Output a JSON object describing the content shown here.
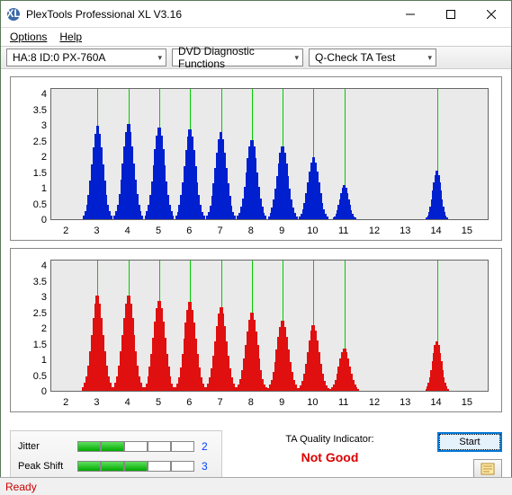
{
  "window": {
    "title": "PlexTools Professional XL V3.16"
  },
  "menu": {
    "options": "Options",
    "help": "Help"
  },
  "toolbar": {
    "drive": "HA:8 ID:0  PX-760A",
    "category": "DVD Diagnostic Functions",
    "test": "Q-Check TA Test"
  },
  "yticks": [
    "4",
    "3.5",
    "3",
    "2.5",
    "2",
    "1.5",
    "1",
    "0.5",
    "0"
  ],
  "xticks": [
    "2",
    "3",
    "4",
    "5",
    "6",
    "7",
    "8",
    "9",
    "10",
    "11",
    "12",
    "13",
    "14",
    "15"
  ],
  "chart_data": [
    {
      "type": "bar",
      "title": "",
      "xlabel": "",
      "ylabel": "",
      "ylim": [
        0,
        4.2
      ],
      "xlim": [
        1.5,
        15.5
      ],
      "color": "#0020d0",
      "gridlines_x": [
        3,
        4,
        5,
        6,
        7,
        8,
        9,
        10,
        11,
        14
      ],
      "series": [
        {
          "name": "peaks",
          "data": [
            {
              "center": 3,
              "width": 0.9,
              "height": 3.0
            },
            {
              "center": 4,
              "width": 0.9,
              "height": 3.05
            },
            {
              "center": 5,
              "width": 0.9,
              "height": 2.95
            },
            {
              "center": 6,
              "width": 0.9,
              "height": 2.9
            },
            {
              "center": 7,
              "width": 0.9,
              "height": 2.8
            },
            {
              "center": 8,
              "width": 0.9,
              "height": 2.55
            },
            {
              "center": 9,
              "width": 0.9,
              "height": 2.35
            },
            {
              "center": 10,
              "width": 0.9,
              "height": 2.0
            },
            {
              "center": 11,
              "width": 0.7,
              "height": 1.1
            },
            {
              "center": 14,
              "width": 0.65,
              "height": 1.55
            }
          ]
        }
      ]
    },
    {
      "type": "bar",
      "title": "",
      "xlabel": "",
      "ylabel": "",
      "ylim": [
        0,
        4.2
      ],
      "xlim": [
        1.5,
        15.5
      ],
      "color": "#e01010",
      "gridlines_x": [
        3,
        4,
        5,
        6,
        7,
        8,
        9,
        10,
        11,
        14
      ],
      "series": [
        {
          "name": "peaks",
          "data": [
            {
              "center": 3,
              "width": 0.95,
              "height": 3.05
            },
            {
              "center": 4,
              "width": 0.95,
              "height": 3.05
            },
            {
              "center": 5,
              "width": 0.95,
              "height": 2.9
            },
            {
              "center": 6,
              "width": 0.95,
              "height": 2.85
            },
            {
              "center": 7,
              "width": 0.95,
              "height": 2.7
            },
            {
              "center": 8,
              "width": 0.95,
              "height": 2.5
            },
            {
              "center": 9,
              "width": 0.95,
              "height": 2.25
            },
            {
              "center": 10,
              "width": 0.95,
              "height": 2.1
            },
            {
              "center": 11,
              "width": 0.9,
              "height": 1.35
            },
            {
              "center": 14,
              "width": 0.7,
              "height": 1.6
            }
          ]
        }
      ]
    }
  ],
  "metrics": {
    "jitter_label": "Jitter",
    "jitter_blocks": 2,
    "jitter_total": 5,
    "jitter_value": "2",
    "peak_label": "Peak Shift",
    "peak_blocks": 3,
    "peak_total": 5,
    "peak_value": "3"
  },
  "quality": {
    "label": "TA Quality Indicator:",
    "value": "Not Good"
  },
  "buttons": {
    "start": "Start"
  },
  "status": "Ready"
}
